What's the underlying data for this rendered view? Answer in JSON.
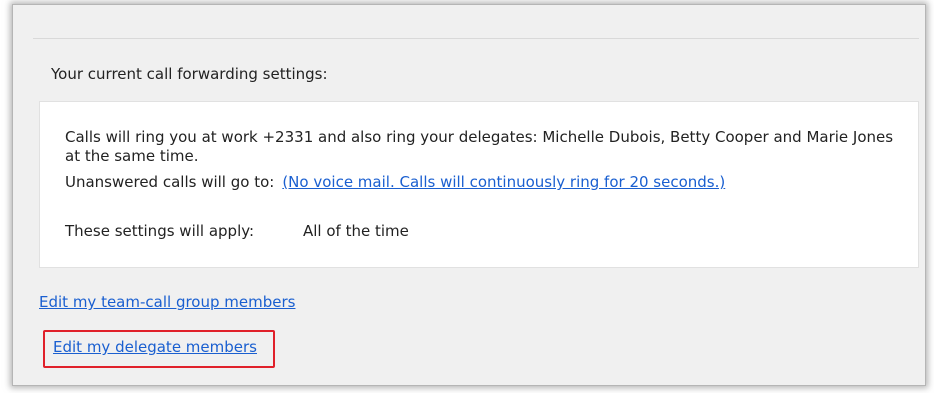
{
  "section_title": "Your current call forwarding settings:",
  "settings": {
    "ring_text": "Calls will ring you at work +2331 and also ring your delegates: Michelle Dubois, Betty Cooper and Marie Jones at the same time.",
    "unanswered_label": "Unanswered calls will go to:",
    "unanswered_link": "(No voice mail. Calls will continuously ring for 20 seconds.)",
    "apply_label": "These settings will apply:",
    "apply_value": "All of the time"
  },
  "links": {
    "team_call": "Edit my team-call group members",
    "delegate": "Edit my delegate members"
  },
  "colors": {
    "link": "#1a5fd0",
    "highlight": "#e0202a"
  }
}
